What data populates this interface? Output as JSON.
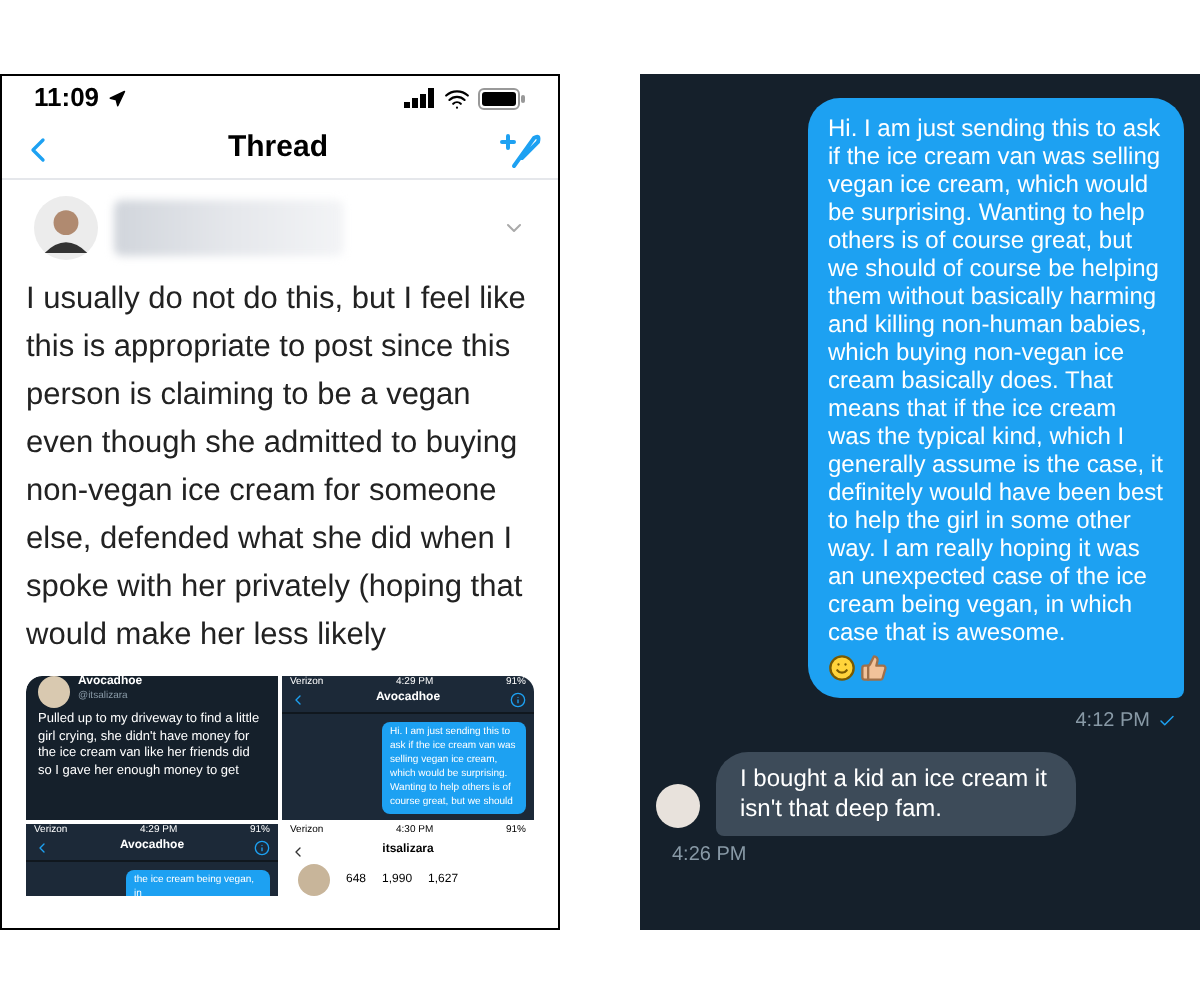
{
  "thread_screen": {
    "status_bar": {
      "time": "11:09"
    },
    "nav": {
      "title": "Thread"
    },
    "tweet": {
      "text": "I usually do not do this, but I feel like this is appropriate to post since this person is claiming to be a vegan even though she admitted to buying non-vegan ice cream for someone else, defended what she did when I spoke with her privately (hoping that would make her less likely"
    },
    "attachments": [
      {
        "kind": "tweet",
        "name": "Avocadhoe",
        "handle": "@itsalizara",
        "text": "Pulled up to my driveway to find a little girl crying, she didn't have money for the ice cream van like her friends did so I gave her enough money to get"
      },
      {
        "kind": "dm",
        "carrier": "Verizon",
        "time": "4:29 PM",
        "battery": "91%",
        "name": "Avocadhoe",
        "text": "Hi. I am just sending this to ask if the ice cream van was selling vegan ice cream, which would be surprising. Wanting to help others is of course great, but we should"
      },
      {
        "kind": "dm",
        "carrier": "Verizon",
        "time": "4:29 PM",
        "battery": "91%",
        "name": "Avocadhoe",
        "text": "the ice cream being vegan, in"
      },
      {
        "kind": "profile",
        "carrier": "Verizon",
        "time": "4:30 PM",
        "battery": "91%",
        "name": "itsalizara",
        "stats": [
          "648",
          "1,990",
          "1,627"
        ]
      }
    ]
  },
  "chat_screen": {
    "messages": [
      {
        "kind": "sent",
        "text": "Hi. I am just sending this to ask if the ice cream van was selling vegan ice cream, which would be surprising. Wanting to help others is of course great, but we should of course be helping them without basically harming and killing non-human babies, which buying non-vegan ice cream basically does. That means that if the ice cream was the typical kind, which I generally assume is the case, it definitely would have been best to help the girl in some other way. I am really hoping it was an unexpected case of the ice cream being vegan, in which case that is awesome.",
        "time": "4:12 PM",
        "read": true
      },
      {
        "kind": "received",
        "text": "I bought a kid an ice cream it isn't that deep fam.",
        "time": "4:26 PM"
      }
    ]
  }
}
